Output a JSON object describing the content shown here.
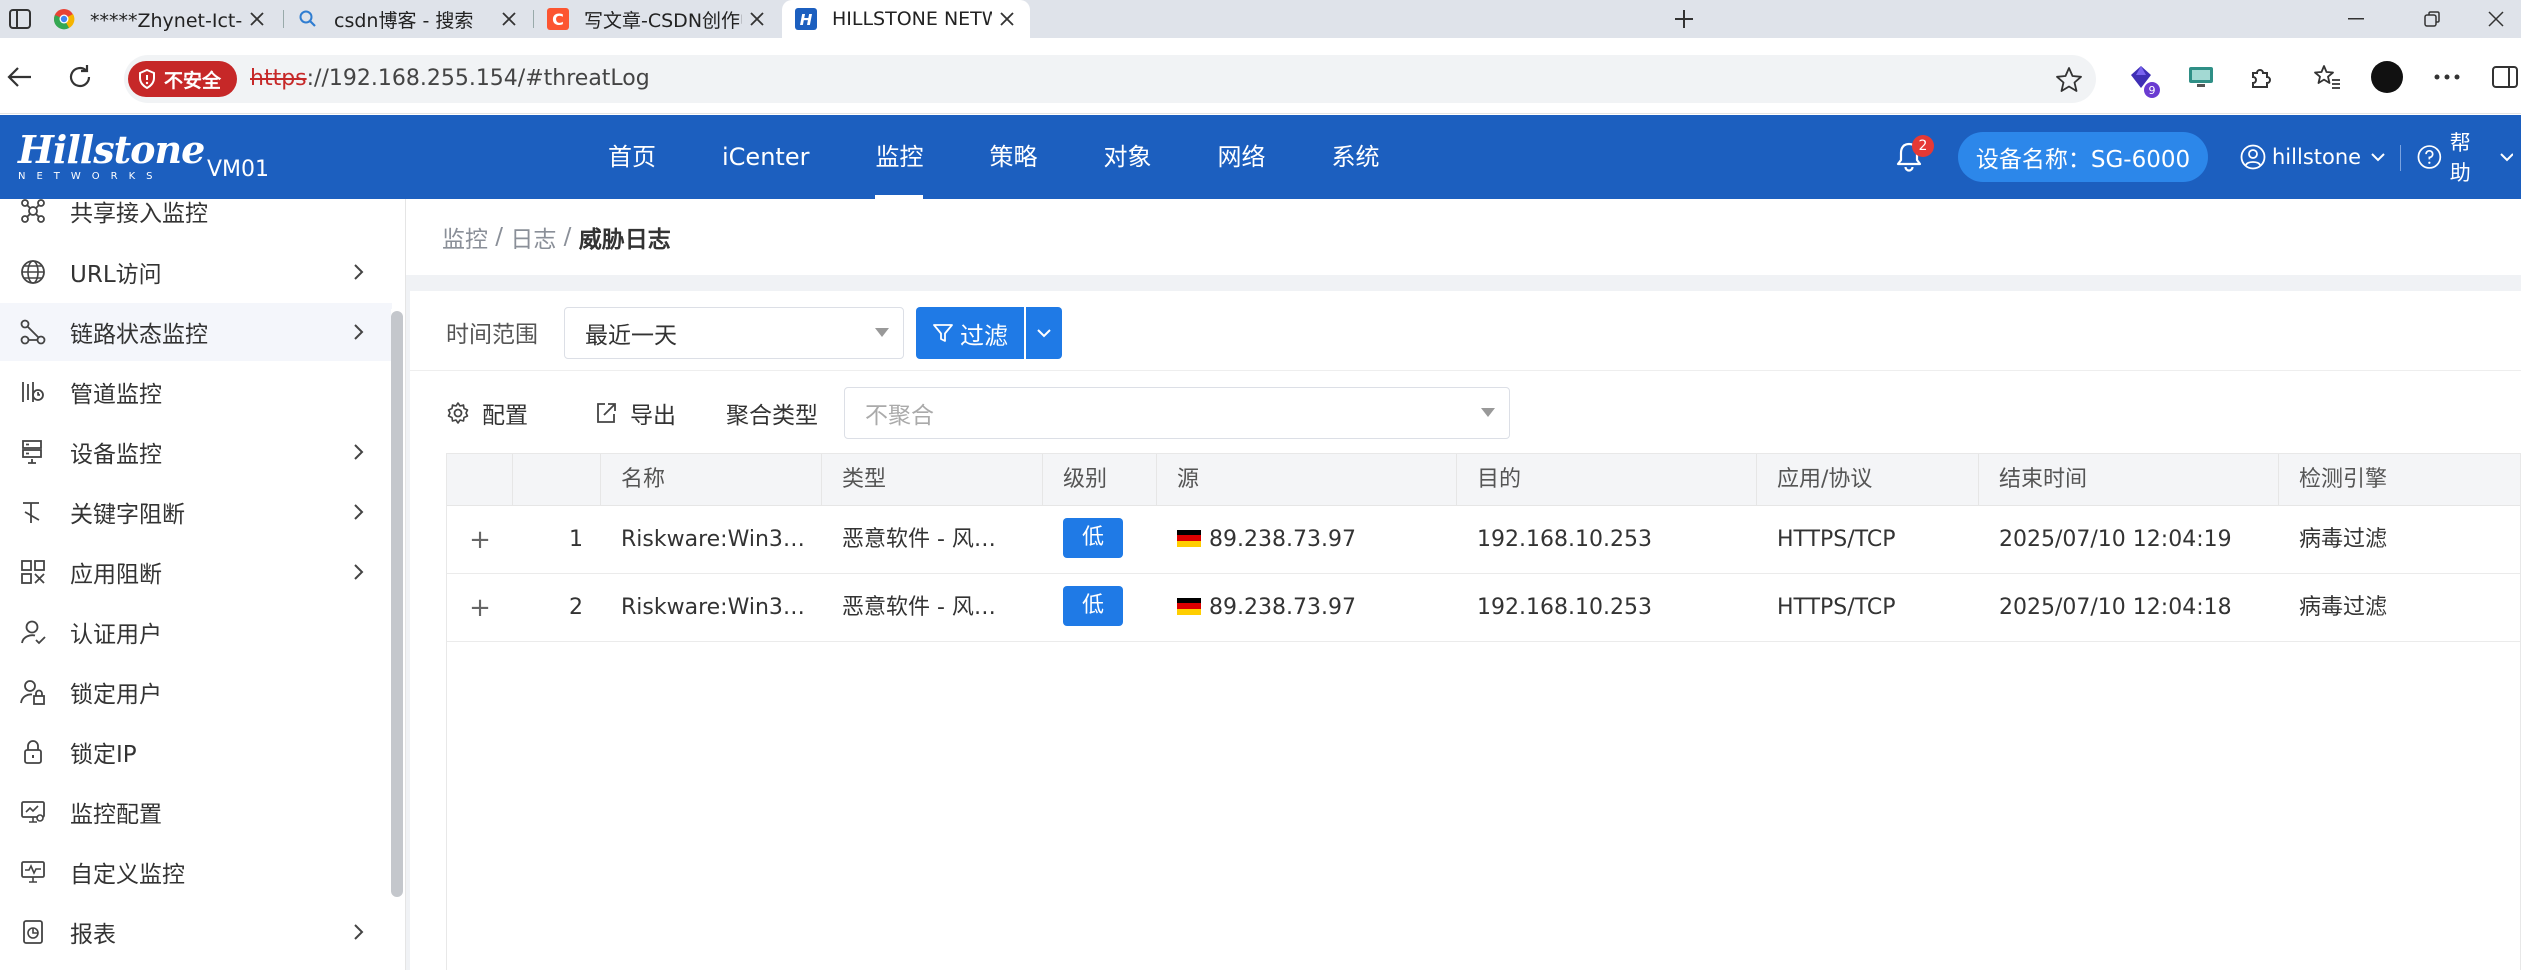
{
  "browser": {
    "tabs": [
      {
        "title": "*****Zhynet-Ict-Lab | 实验拓扑图*",
        "active": false
      },
      {
        "title": "csdn博客 - 搜索",
        "active": false
      },
      {
        "title": "写文章-CSDN创作中心",
        "active": false
      },
      {
        "title": "HILLSTONE NETWORKS",
        "active": true
      }
    ],
    "security_label": "不安全",
    "url_protocol": "https",
    "url_rest": "://192.168.255.154/#threatLog",
    "extension_badge": "9"
  },
  "app": {
    "brand": "Hillstone",
    "brand_sub": "NETWORKS",
    "model": "VM01",
    "nav": [
      "首页",
      "iCenter",
      "监控",
      "策略",
      "对象",
      "网络",
      "系统"
    ],
    "active_nav": "监控",
    "notification_count": "2",
    "device_name": "设备名称：SG-6000",
    "user": "hillstone",
    "help": "帮助"
  },
  "sidebar": {
    "items": [
      {
        "label": "共享接入监控",
        "icon": "share-monitor-icon",
        "has_children": false
      },
      {
        "label": "URL访问",
        "icon": "globe-icon",
        "has_children": true
      },
      {
        "label": "链路状态监控",
        "icon": "link-status-icon",
        "has_children": true
      },
      {
        "label": "管道监控",
        "icon": "pipe-monitor-icon",
        "has_children": false
      },
      {
        "label": "设备监控",
        "icon": "device-monitor-icon",
        "has_children": true
      },
      {
        "label": "关键字阻断",
        "icon": "keyword-block-icon",
        "has_children": true
      },
      {
        "label": "应用阻断",
        "icon": "app-block-icon",
        "has_children": true
      },
      {
        "label": "认证用户",
        "icon": "auth-user-icon",
        "has_children": false
      },
      {
        "label": "锁定用户",
        "icon": "locked-user-icon",
        "has_children": false
      },
      {
        "label": "锁定IP",
        "icon": "lock-icon",
        "has_children": false
      },
      {
        "label": "监控配置",
        "icon": "monitor-config-icon",
        "has_children": false
      },
      {
        "label": "自定义监控",
        "icon": "custom-monitor-icon",
        "has_children": false
      },
      {
        "label": "报表",
        "icon": "report-icon",
        "has_children": true
      }
    ]
  },
  "breadcrumb": {
    "part1": "监控",
    "sep": " / ",
    "part2": "日志",
    "current": "威胁日志"
  },
  "filter": {
    "time_label": "时间范围",
    "time_value": "最近一天",
    "filter_button": "过滤"
  },
  "toolbar": {
    "config": "配置",
    "export": "导出",
    "agg_label": "聚合类型",
    "agg_placeholder": "不聚合"
  },
  "table": {
    "columns": [
      "名称",
      "类型",
      "级别",
      "源",
      "目的",
      "应用/协议",
      "结束时间",
      "检测引擎"
    ],
    "rows": [
      {
        "index": "1",
        "name": "Riskware:Win3…",
        "type": "恶意软件 - 风…",
        "level": "低",
        "src": "89.238.73.97",
        "dst": "192.168.10.253",
        "app": "HTTPS/TCP",
        "end": "2025/07/10 12:04:19",
        "engine": "病毒过滤"
      },
      {
        "index": "2",
        "name": "Riskware:Win3…",
        "type": "恶意软件 - 风…",
        "level": "低",
        "src": "89.238.73.97",
        "dst": "192.168.10.253",
        "app": "HTTPS/TCP",
        "end": "2025/07/10 12:04:18",
        "engine": "病毒过滤"
      }
    ]
  },
  "colors": {
    "header": "#1c5fbf",
    "accent": "#1f7ae6",
    "danger": "#c62828"
  }
}
